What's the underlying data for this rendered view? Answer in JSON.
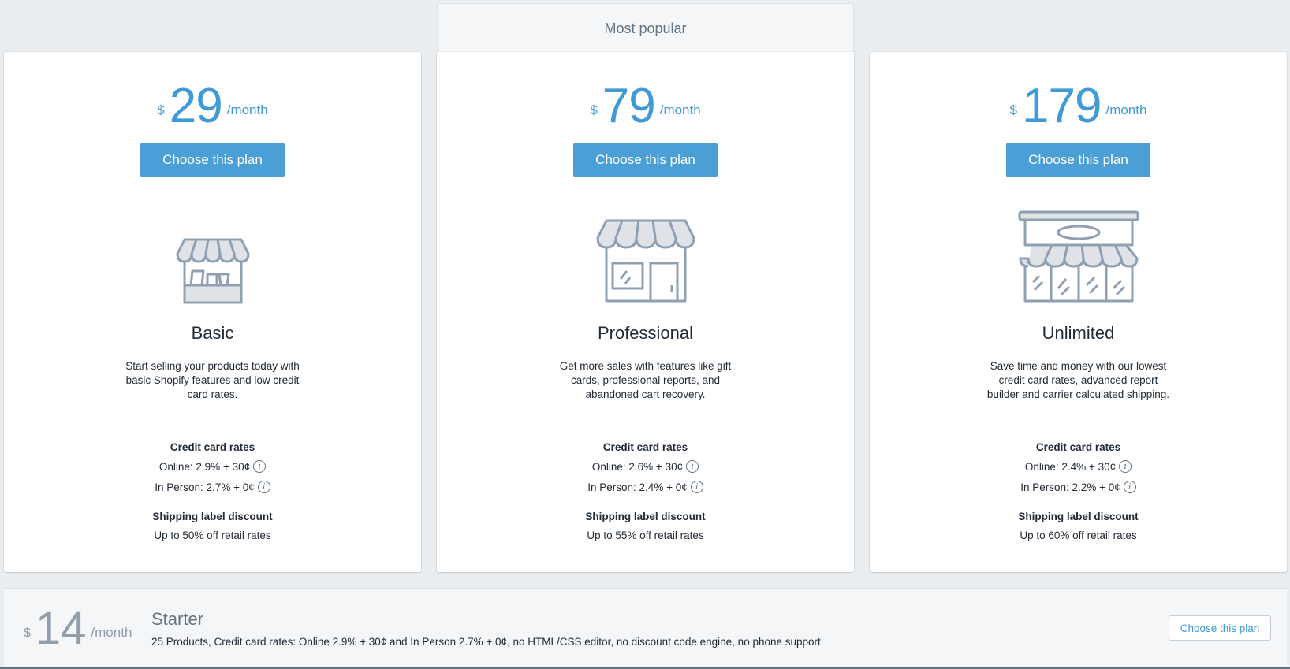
{
  "popular_label": "Most popular",
  "colors": {
    "accent": "#4a9fd6",
    "price": "#3f9ad6",
    "icon_stroke": "#8fa0b3",
    "icon_fill": "#dfe3e8"
  },
  "plans": [
    {
      "currency": "$",
      "amount": "29",
      "period": "/month",
      "button": "Choose this plan",
      "icon": "small-store-icon",
      "name": "Basic",
      "description": "Start selling your products today with basic Shopify features and low credit card rates.",
      "rates_heading": "Credit card rates",
      "online": "Online: 2.9% + 30¢",
      "in_person": "In Person: 2.7% + 0¢",
      "shipping_heading": "Shipping label discount",
      "shipping": "Up to 50% off retail rates"
    },
    {
      "currency": "$",
      "amount": "79",
      "period": "/month",
      "button": "Choose this plan",
      "icon": "medium-store-icon",
      "name": "Professional",
      "description": "Get more sales with features like gift cards, professional reports, and abandoned cart recovery.",
      "rates_heading": "Credit card rates",
      "online": "Online: 2.6% + 30¢",
      "in_person": "In Person: 2.4% + 0¢",
      "shipping_heading": "Shipping label discount",
      "shipping": "Up to 55% off retail rates"
    },
    {
      "currency": "$",
      "amount": "179",
      "period": "/month",
      "button": "Choose this plan",
      "icon": "large-store-icon",
      "name": "Unlimited",
      "description": "Save time and money with our lowest credit card rates, advanced report builder and carrier calculated shipping.",
      "rates_heading": "Credit card rates",
      "online": "Online: 2.4% + 30¢",
      "in_person": "In Person: 2.2% + 0¢",
      "shipping_heading": "Shipping label discount",
      "shipping": "Up to 60% off retail rates"
    }
  ],
  "info_glyph": "i",
  "starter": {
    "currency": "$",
    "amount": "14",
    "period": "/month",
    "name": "Starter",
    "description": "25 Products, Credit card rates: Online 2.9% + 30¢ and In Person 2.7% + 0¢, no HTML/CSS editor, no discount code engine, no phone support",
    "button": "Choose this plan"
  }
}
